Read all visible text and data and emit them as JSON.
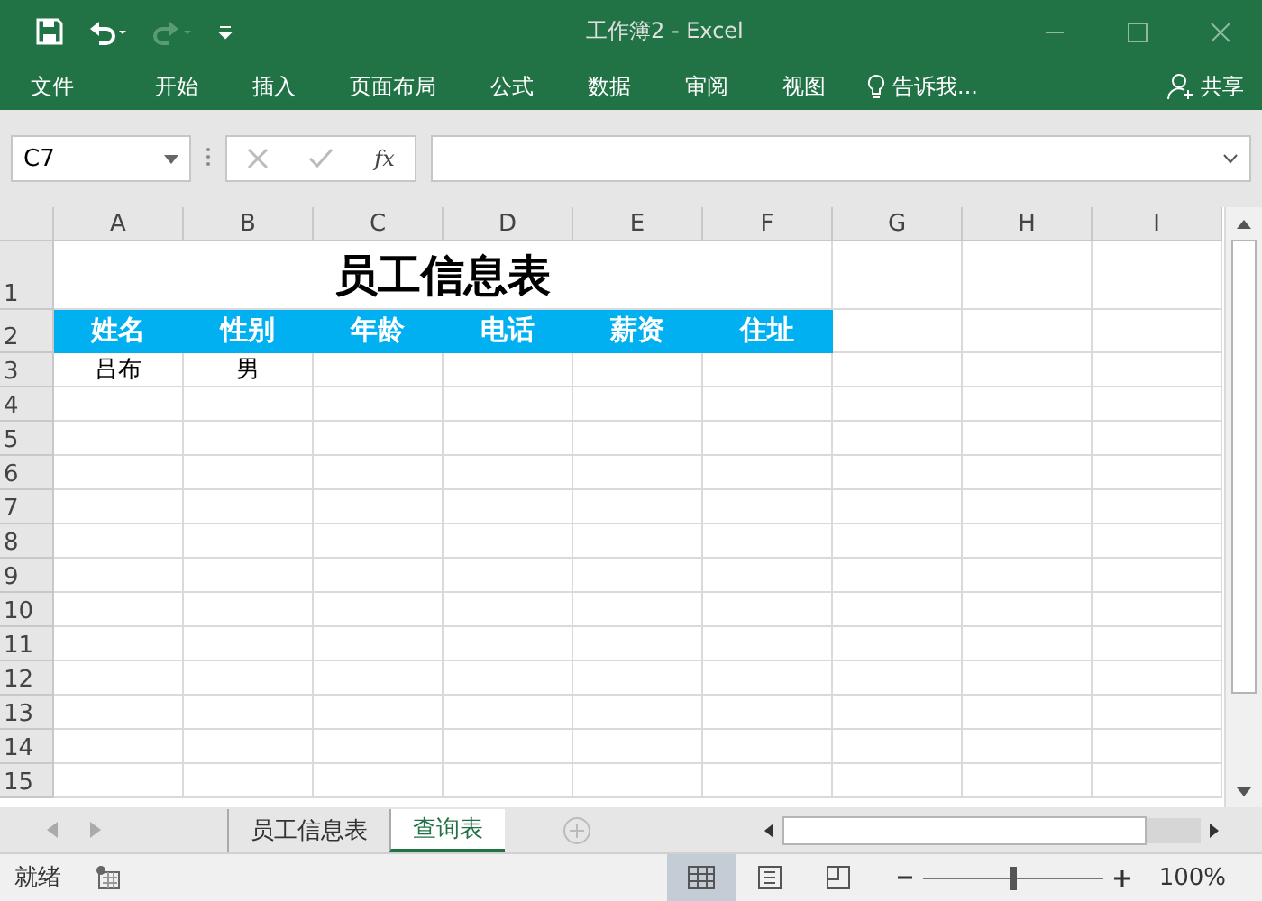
{
  "window": {
    "title": "工作簿2 - Excel"
  },
  "ribbon_tabs": [
    {
      "label": "文件"
    },
    {
      "label": "开始"
    },
    {
      "label": "插入"
    },
    {
      "label": "页面布局"
    },
    {
      "label": "公式"
    },
    {
      "label": "数据"
    },
    {
      "label": "审阅"
    },
    {
      "label": "视图"
    }
  ],
  "tell_me": {
    "placeholder": "告诉我..."
  },
  "share": {
    "label": "共享"
  },
  "name_box": {
    "value": "C7"
  },
  "formula_bar": {
    "fx": "fx"
  },
  "columns": [
    "A",
    "B",
    "C",
    "D",
    "E",
    "F",
    "G",
    "H",
    "I"
  ],
  "title_row": {
    "number": "1",
    "text": "员工信息表"
  },
  "header_row": {
    "number": "2",
    "cells": [
      "姓名",
      "性别",
      "年龄",
      "电话",
      "薪资",
      "住址"
    ]
  },
  "rows": [
    {
      "number": "3",
      "cells": [
        "吕布",
        "男"
      ]
    },
    {
      "number": "4"
    },
    {
      "number": "5"
    },
    {
      "number": "6"
    },
    {
      "number": "7"
    },
    {
      "number": "8"
    },
    {
      "number": "9"
    },
    {
      "number": "10"
    },
    {
      "number": "11"
    },
    {
      "number": "12"
    },
    {
      "number": "13"
    },
    {
      "number": "14"
    },
    {
      "number": "15"
    }
  ],
  "sheet_tabs": [
    {
      "label": "员工信息表",
      "selected": false
    },
    {
      "label": "查询表",
      "selected": true
    }
  ],
  "status_bar": {
    "status": "就绪",
    "views": [
      {
        "kind": "normal",
        "selected": true
      },
      {
        "kind": "layout",
        "selected": false
      },
      {
        "kind": "preview",
        "selected": false
      }
    ],
    "zoom": {
      "level": 0.5,
      "reading": "100%"
    }
  }
}
